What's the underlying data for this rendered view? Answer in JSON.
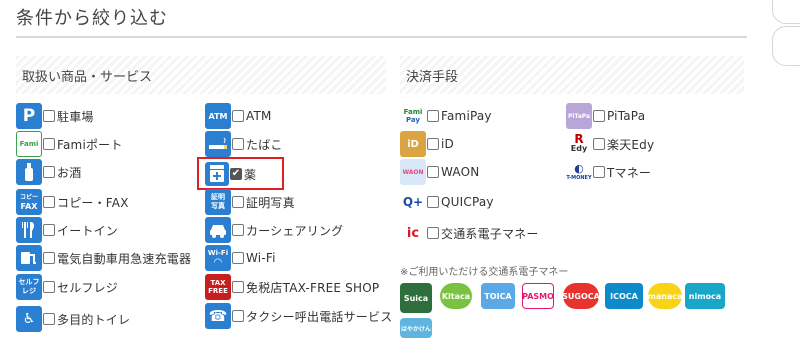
{
  "page": {
    "title": "条件から絞り込む"
  },
  "sections": {
    "products": "取扱い商品・サービス",
    "payment": "決済手段"
  },
  "products_col1": [
    {
      "label": "駐車場",
      "icon": "P"
    },
    {
      "label": "Famiポート",
      "icon": "Fami"
    },
    {
      "label": "お酒",
      "icon": "bottle"
    },
    {
      "label": "コピー・FAX",
      "icon": "FAX"
    },
    {
      "label": "イートイン",
      "icon": "fork-knife"
    },
    {
      "label": "電気自動車用急速充電器",
      "icon": "ev"
    },
    {
      "label": "セルフレジ",
      "icon": "セルフレジ"
    },
    {
      "label": "多目的トイレ",
      "icon": "wheelchair"
    }
  ],
  "products_col2": [
    {
      "label": "ATM",
      "icon": "ATM"
    },
    {
      "label": "たばこ",
      "icon": "cigarette"
    },
    {
      "label": "薬",
      "icon": "medicine",
      "checked": true
    },
    {
      "label": "証明写真",
      "icon": "証明写真"
    },
    {
      "label": "カーシェアリング",
      "icon": "car"
    },
    {
      "label": "Wi-Fi",
      "icon": "Wi-Fi"
    },
    {
      "label": "免税店TAX-FREE SHOP",
      "icon": "TAX FREE"
    },
    {
      "label": "タクシー呼出電話サービス",
      "icon": "phone"
    }
  ],
  "payment_col1": [
    {
      "label": "FamiPay",
      "icon": "Fami Pay"
    },
    {
      "label": "iD",
      "icon": "iD"
    },
    {
      "label": "WAON",
      "icon": "WAON"
    },
    {
      "label": "QUICPay",
      "icon": "QUICPay"
    },
    {
      "label": "交通系電子マネー",
      "icon": "ic"
    }
  ],
  "payment_col2": [
    {
      "label": "PiTaPa",
      "icon": "PiTaPa"
    },
    {
      "label": "楽天Edy",
      "icon": "R Edy"
    },
    {
      "label": "Tマネー",
      "icon": "T-MONEY"
    }
  ],
  "transit_note": "※ご利用いただける交通系電子マネー",
  "transit_cards": [
    {
      "name": "Suica",
      "bg": "#2f6f3e",
      "fg": "#ffffff"
    },
    {
      "name": "Kitaca",
      "bg": "#7cc242",
      "fg": "#ffffff"
    },
    {
      "name": "TOICA",
      "bg": "#5aa9e6",
      "fg": "#ffffff"
    },
    {
      "name": "PASMO",
      "bg": "#ffffff",
      "fg": "#e61873"
    },
    {
      "name": "SUGOCA",
      "bg": "#e8322e",
      "fg": "#ffffff"
    },
    {
      "name": "ICOCA",
      "bg": "#0c8ac9",
      "fg": "#ffffff"
    },
    {
      "name": "manaca",
      "bg": "#f7d418",
      "fg": "#ffffff"
    },
    {
      "name": "nimoca",
      "bg": "#19a7c9",
      "fg": "#ffffff"
    },
    {
      "name": "はやかけん",
      "bg": "#5fb4e0",
      "fg": "#ffffff"
    }
  ],
  "colors": {
    "accent_blue": "#2b7fd0",
    "highlight_red": "#e02020"
  }
}
